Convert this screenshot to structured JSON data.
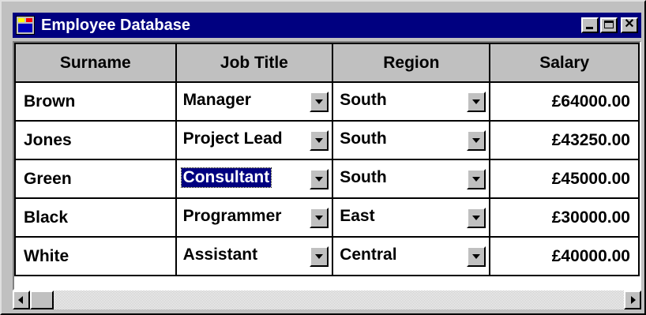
{
  "window": {
    "title": "Employee Database",
    "icon": "app-icon"
  },
  "columns": [
    "Surname",
    "Job Title",
    "Region",
    "Salary"
  ],
  "rows": [
    {
      "surname": "Brown",
      "job_title": "Manager",
      "region": "South",
      "salary": "£64000.00"
    },
    {
      "surname": "Jones",
      "job_title": "Project Lead",
      "region": "South",
      "salary": "£43250.00"
    },
    {
      "surname": "Green",
      "job_title": "Consultant",
      "region": "South",
      "salary": "£45000.00"
    },
    {
      "surname": "Black",
      "job_title": "Programmer",
      "region": "East",
      "salary": "£30000.00"
    },
    {
      "surname": "White",
      "job_title": "Assistant",
      "region": "Central",
      "salary": "£40000.00"
    }
  ],
  "selected_cell": {
    "row": 2,
    "column": "Job Title"
  },
  "colors": {
    "titlebar": "#000080",
    "selection": "#000080",
    "face": "#c0c0c0"
  }
}
